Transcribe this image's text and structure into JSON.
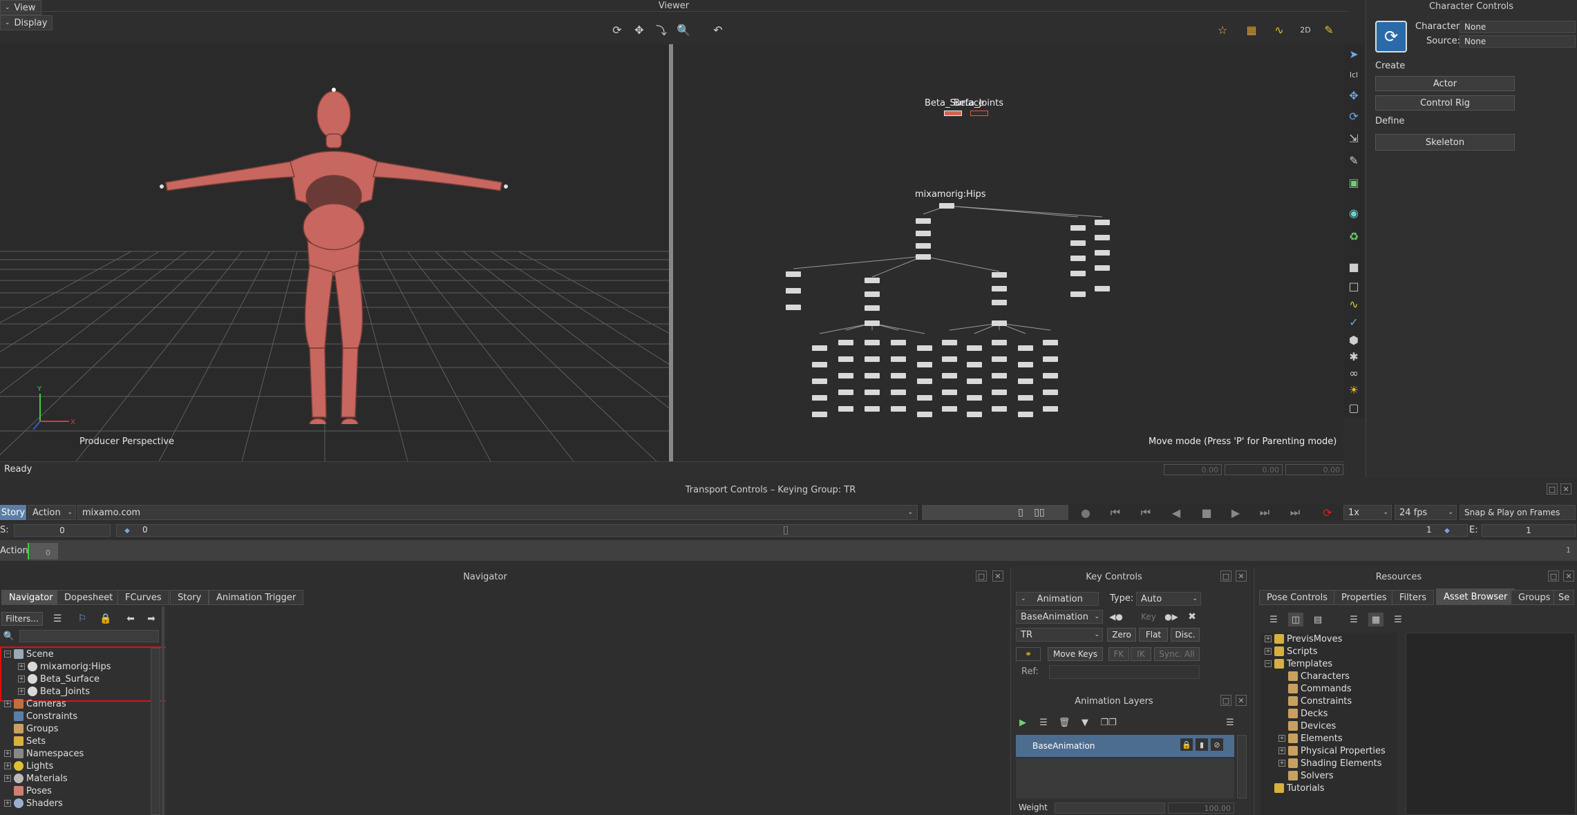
{
  "viewer": {
    "title": "Viewer",
    "view_menu": "View",
    "display_menu": "Display",
    "perspective_label": "Producer Perspective",
    "status": "Ready",
    "mode_hint": "Move mode (Press 'P' for Parenting mode)",
    "schematic": {
      "surface_label": "Beta_Surface",
      "joints_label": "Beta_Joints",
      "hips_label": "mixamorig:Hips"
    },
    "coord_values": [
      "0.00",
      "0.00",
      "0.00"
    ]
  },
  "character_controls": {
    "title": "Character Controls",
    "character_label": "Character:",
    "character_value": "None",
    "source_label": "Source:",
    "source_value": "None",
    "create_label": "Create",
    "actor_button": "Actor",
    "control_rig_button": "Control Rig",
    "define_label": "Define",
    "skeleton_button": "Skeleton"
  },
  "transport": {
    "title": "Transport Controls  –  Keying Group: TR",
    "story_tab": "Story",
    "action_dropdown": "Action",
    "take_name": "mixamo.com",
    "speed": "1x",
    "fps": "24 fps",
    "snap_mode": "Snap & Play on Frames",
    "start_label": "S:",
    "start_value": "0",
    "current_frame": "0",
    "end_frame_marker": "1",
    "end_label": "E:",
    "end_value": "1",
    "action_label": "Action",
    "action_frame": "0",
    "action_end": "1"
  },
  "navigator": {
    "title": "Navigator",
    "tabs": [
      "Navigator",
      "Dopesheet",
      "FCurves",
      "Story",
      "Animation Trigger"
    ],
    "filters_button": "Filters...",
    "search_placeholder": "",
    "tree": [
      {
        "label": "Scene",
        "expander": "−",
        "icon": "scene-icon",
        "level": 0
      },
      {
        "label": "mixamorig:Hips",
        "expander": "+",
        "icon": "model-icon",
        "level": 1
      },
      {
        "label": "Beta_Surface",
        "expander": "+",
        "icon": "model-icon",
        "level": 1
      },
      {
        "label": "Beta_Joints",
        "expander": "+",
        "icon": "model-icon",
        "level": 1
      },
      {
        "label": "Cameras",
        "expander": "+",
        "icon": "camera-icon",
        "level": 0
      },
      {
        "label": "Constraints",
        "expander": "",
        "icon": "constraint-icon",
        "level": 0
      },
      {
        "label": "Groups",
        "expander": "",
        "icon": "group-icon",
        "level": 0
      },
      {
        "label": "Sets",
        "expander": "",
        "icon": "set-icon",
        "level": 0
      },
      {
        "label": "Namespaces",
        "expander": "+",
        "icon": "namespace-icon",
        "level": 0
      },
      {
        "label": "Lights",
        "expander": "+",
        "icon": "light-icon",
        "level": 0
      },
      {
        "label": "Materials",
        "expander": "+",
        "icon": "material-icon",
        "level": 0
      },
      {
        "label": "Poses",
        "expander": "",
        "icon": "pose-icon",
        "level": 0
      },
      {
        "label": "Shaders",
        "expander": "+",
        "icon": "shader-icon",
        "level": 0
      }
    ]
  },
  "key_controls": {
    "title": "Key Controls",
    "animation_dropdown": "Animation",
    "type_label": "Type:",
    "type_value": "Auto",
    "layer_dropdown": "BaseAnimation",
    "key_button": "Key",
    "group_dropdown": "TR",
    "zero_button": "Zero",
    "flat_button": "Flat",
    "disc_button": "Disc.",
    "move_keys_button": "Move Keys",
    "fk_button": "FK",
    "ik_button": "IK",
    "sync_button": "Sync. All",
    "ref_label": "Ref:",
    "layers_title": "Animation Layers",
    "base_layer": "BaseAnimation",
    "weight_label": "Weight",
    "weight_value": "100.00"
  },
  "resources": {
    "title": "Resources",
    "tabs": [
      "Pose Controls",
      "Properties",
      "Filters",
      "Asset Browser",
      "Groups",
      "Se"
    ],
    "active_tab": "Asset Browser",
    "tree": [
      {
        "label": "PrevisMoves",
        "expander": "+",
        "level": 0
      },
      {
        "label": "Scripts",
        "expander": "+",
        "level": 0
      },
      {
        "label": "Templates",
        "expander": "−",
        "level": 0
      },
      {
        "label": "Characters",
        "expander": "",
        "level": 1
      },
      {
        "label": "Commands",
        "expander": "",
        "level": 1
      },
      {
        "label": "Constraints",
        "expander": "",
        "level": 1
      },
      {
        "label": "Decks",
        "expander": "",
        "level": 1
      },
      {
        "label": "Devices",
        "expander": "",
        "level": 1
      },
      {
        "label": "Elements",
        "expander": "+",
        "level": 1
      },
      {
        "label": "Physical Properties",
        "expander": "+",
        "level": 1
      },
      {
        "label": "Shading Elements",
        "expander": "+",
        "level": 1
      },
      {
        "label": "Solvers",
        "expander": "",
        "level": 1
      },
      {
        "label": "Tutorials",
        "expander": "",
        "level": 0
      }
    ]
  },
  "colors": {
    "accent_blue": "#5a7ea8",
    "highlight_red": "#e01010",
    "character_skin": "#c8675f"
  }
}
